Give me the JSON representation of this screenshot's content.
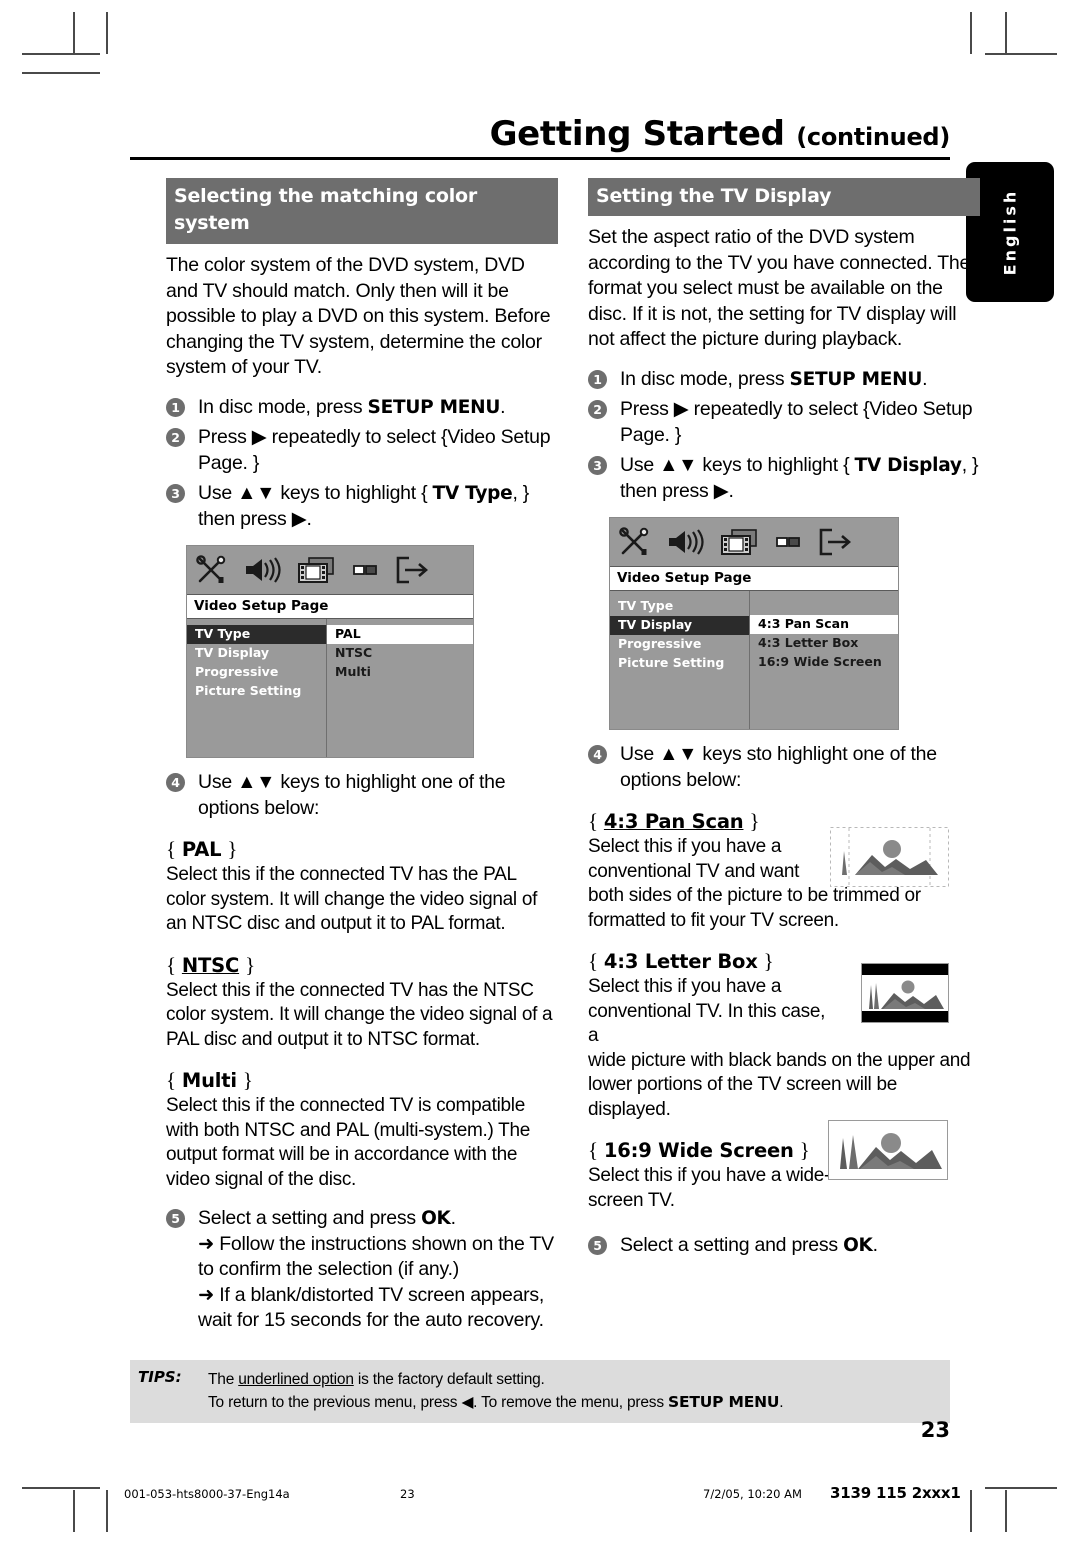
{
  "header": {
    "title_main": "Getting Started",
    "title_suffix": "(continued)"
  },
  "language_tab": {
    "label": "English"
  },
  "left_column": {
    "section_heading": "Selecting the matching color system",
    "intro": "The color system of the DVD system, DVD and TV should match. Only then will it be possible to play a DVD on this system.  Before changing the TV system, determine the color system of your TV.",
    "steps": [
      {
        "num": "1",
        "pre": "In disc mode, press ",
        "bold": "SETUP MENU",
        "post": "."
      },
      {
        "num": "2",
        "pre": "Press ▶ repeatedly to select {Video Setup Page. }",
        "bold": "",
        "post": ""
      },
      {
        "num": "3",
        "pre": "Use ▲▼ keys to highlight { ",
        "bold": "TV Type",
        "post": ", } then press ▶."
      }
    ],
    "osd": {
      "title": "Video Setup Page",
      "menu_items": [
        "TV Type",
        "TV Display",
        "Progressive",
        "Picture Setting"
      ],
      "selected_menu_index": 0,
      "options": [
        "PAL",
        "NTSC",
        "Multi"
      ],
      "selected_option_index": 0,
      "icons": [
        "tools-icon",
        "speaker-icon",
        "film-icon",
        "preference-icon",
        "exit-icon"
      ]
    },
    "step4": {
      "num": "4",
      "text": "Use ▲▼ keys to highlight one of the options below:"
    },
    "options": [
      {
        "name": "PAL",
        "underlined": false,
        "desc": "Select this if the connected TV has the PAL color system. It will change the video signal of an NTSC disc and output it to PAL format."
      },
      {
        "name": "NTSC",
        "underlined": true,
        "desc": "Select this if the connected TV has the NTSC color system. It will change the video signal of a PAL disc and output it to NTSC format."
      },
      {
        "name": "Multi",
        "underlined": false,
        "desc": "Select this if the connected TV is compatible with both NTSC and PAL (multi-system.) The output format will be in accordance with the video signal of the disc."
      }
    ],
    "step5": {
      "num": "5",
      "pre": "Select a setting and press ",
      "bold": "OK",
      "post": ".",
      "arrows": [
        "➜ Follow the instructions shown on the TV to confirm the selection (if any.)",
        "➜ If a blank/distorted TV screen appears, wait for 15 seconds for the auto recovery."
      ]
    }
  },
  "right_column": {
    "section_heading": "Setting the TV Display",
    "intro": "Set the aspect ratio of the DVD system according to the TV you have connected. The format you select must be available on the disc.  If it is not, the setting for TV display will not affect the picture during playback.",
    "steps": [
      {
        "num": "1",
        "pre": "In disc mode, press ",
        "bold": "SETUP MENU",
        "post": "."
      },
      {
        "num": "2",
        "pre": "Press ▶ repeatedly to select {Video Setup Page. }",
        "bold": "",
        "post": ""
      },
      {
        "num": "3",
        "pre": "Use ▲▼ keys to highlight { ",
        "bold": "TV Display",
        "post": ", } then press ▶."
      }
    ],
    "osd": {
      "title": "Video Setup Page",
      "menu_items": [
        "TV Type",
        "TV Display",
        "Progressive",
        "Picture Setting"
      ],
      "selected_menu_index": 1,
      "options": [
        "4:3 Pan Scan",
        "4:3 Letter Box",
        "16:9 Wide Screen"
      ],
      "selected_option_index": 0,
      "icons": [
        "tools-icon",
        "speaker-icon",
        "film-icon",
        "preference-icon",
        "exit-icon"
      ]
    },
    "step4": {
      "num": "4",
      "text": "Use ▲▼ keys sto highlight one of the options below:"
    },
    "options": [
      {
        "name": "4:3 Pan Scan",
        "underlined": true,
        "desc_narrow": "Select this if you have a conventional TV and want",
        "desc_full": "both sides of the picture to be trimmed or formatted to fit your TV screen.",
        "thumb": "pan-scan-thumbnail"
      },
      {
        "name": "4:3 Letter Box",
        "underlined": false,
        "desc_narrow": "Select this if you have a conventional TV.  In this case, a",
        "desc_full": "wide picture with black bands on the upper and lower portions of the TV screen will be displayed.",
        "thumb": "letter-box-thumbnail"
      },
      {
        "name": "16:9 Wide Screen",
        "underlined": false,
        "desc_narrow": "Select this if you have a wide-screen TV.",
        "desc_full": "",
        "thumb": "wide-screen-thumbnail"
      }
    ],
    "step5": {
      "num": "5",
      "pre": "Select a setting and press ",
      "bold": "OK",
      "post": "."
    }
  },
  "tips": {
    "label": "TIPS:",
    "line1_pre": "The ",
    "line1_underline": "underlined option",
    "line1_post": " is the factory default setting.",
    "line2_pre": "To return to the previous menu, press ◀.  To remove the menu, press ",
    "line2_bold": "SETUP MENU",
    "line2_post": "."
  },
  "page_number": "23",
  "print_footer": {
    "file": "001-053-hts8000-37-Eng14a",
    "page": "23",
    "date": "7/2/05, 10:20 AM",
    "code": "3139 115 2xxx1"
  },
  "colors": {
    "section_heading_bg": "#6e6e6e",
    "tips_bg": "#dcdcdc",
    "osd_bg": "#9a9a9a",
    "osd_selected": "#2b2b2b",
    "lang_tab_bg": "#000000"
  }
}
